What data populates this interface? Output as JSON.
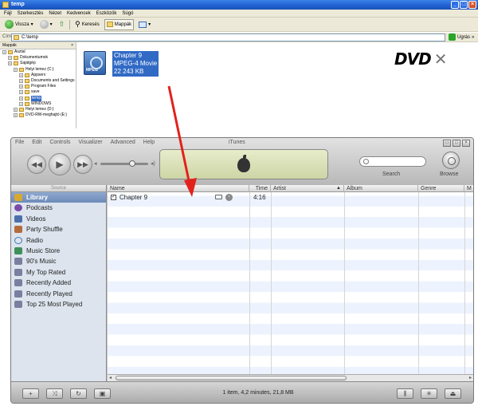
{
  "explorer": {
    "title": "temp",
    "menu": [
      "Fájl",
      "Szerkesztés",
      "Nézet",
      "Kedvencek",
      "Eszközök",
      "Súgó"
    ],
    "toolbar": {
      "back": "Vissza",
      "search": "Keresés",
      "folders": "Mappák"
    },
    "address": {
      "label": "Cím",
      "value": "C:\\temp",
      "go": "Ugrás",
      "links": "»"
    },
    "folders_pane": {
      "title": "Mappák",
      "items": [
        {
          "label": "Asztal",
          "indent": 0
        },
        {
          "label": "Dokumentumok",
          "indent": 1
        },
        {
          "label": "Sajátgép",
          "indent": 1
        },
        {
          "label": "Helyi lemez (C:)",
          "indent": 2
        },
        {
          "label": "Appserv",
          "indent": 3
        },
        {
          "label": "Documents and Settings",
          "indent": 3
        },
        {
          "label": "Program Files",
          "indent": 3
        },
        {
          "label": "save",
          "indent": 3
        },
        {
          "label": "temp",
          "indent": 3,
          "selected": true
        },
        {
          "label": "WINDOWS",
          "indent": 3
        },
        {
          "label": "Helyi lemez (D:)",
          "indent": 2
        },
        {
          "label": "DVD-RW-meghajtó (E:)",
          "indent": 2
        }
      ]
    },
    "file": {
      "name": "Chapter 9",
      "type": "MPEG-4 Movie",
      "size": "22 243 KB",
      "icon_text": "MPEG"
    },
    "logo": {
      "text": "DVD"
    }
  },
  "itunes": {
    "menu": [
      "File",
      "Edit",
      "Controls",
      "Visualizer",
      "Advanced",
      "Help"
    ],
    "window_title": "iTunes",
    "search_label": "Search",
    "browse_label": "Browse",
    "source_header": "Source",
    "sources": [
      {
        "label": "Library",
        "icon": "library-icon",
        "selected": true
      },
      {
        "label": "Podcasts",
        "icon": "podcast-icon"
      },
      {
        "label": "Videos",
        "icon": "videos-icon"
      },
      {
        "label": "Party Shuffle",
        "icon": "shuffle-icon"
      },
      {
        "label": "Radio",
        "icon": "radio-icon"
      },
      {
        "label": "Music Store",
        "icon": "store-icon"
      },
      {
        "label": "90's Music",
        "icon": "smart-playlist-icon"
      },
      {
        "label": "My Top Rated",
        "icon": "smart-playlist-icon"
      },
      {
        "label": "Recently Added",
        "icon": "smart-playlist-icon"
      },
      {
        "label": "Recently Played",
        "icon": "smart-playlist-icon"
      },
      {
        "label": "Top 25 Most Played",
        "icon": "smart-playlist-icon"
      }
    ],
    "columns": {
      "name": "Name",
      "time": "Time",
      "artist": "Artist",
      "album": "Album",
      "genre": "Genre",
      "more": "M"
    },
    "tracks": [
      {
        "name": "Chapter 9",
        "time": "4:16",
        "artist": "",
        "album": "",
        "genre": ""
      }
    ],
    "status": "1 item, 4,2 minutes, 21,8 MB",
    "volume_level": 0.7
  }
}
